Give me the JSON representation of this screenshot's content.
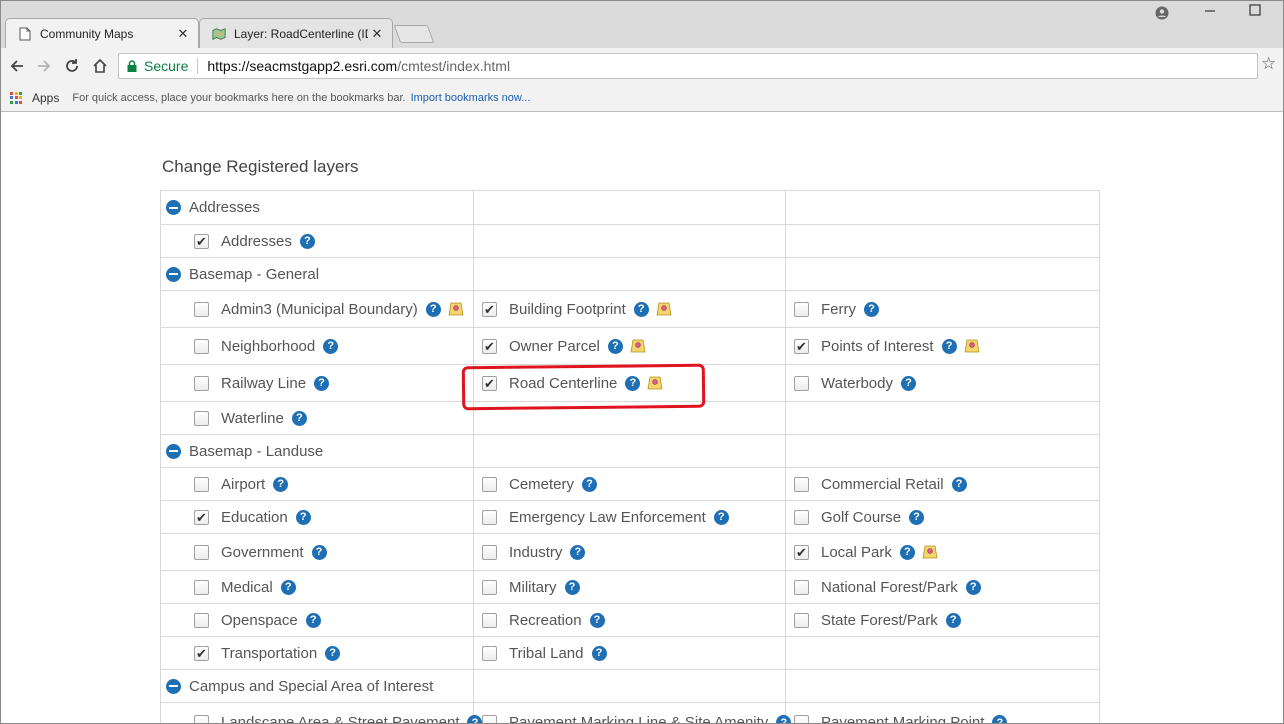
{
  "browser": {
    "tabs": [
      {
        "title": "Community Maps",
        "close": "✕",
        "icon": "page-icon"
      },
      {
        "title": "Layer: RoadCenterline (ID",
        "close": "✕",
        "icon": "map-icon"
      }
    ],
    "address": {
      "secure_label": "Secure",
      "url_host": "https://seacmstgapp2.esri.com",
      "url_path": "/cmtest/index.html"
    },
    "bookmarks": {
      "apps_label": "Apps",
      "hint": "For quick access, place your bookmarks here on the bookmarks bar.",
      "import_link": "Import bookmarks now..."
    }
  },
  "page": {
    "title": "Change Registered layers",
    "groups": [
      {
        "name": "Addresses",
        "rows": [
          [
            {
              "label": "Addresses",
              "checked": true,
              "tag": false
            },
            null,
            null
          ]
        ]
      },
      {
        "name": "Basemap - General",
        "rows": [
          [
            {
              "label": "Admin3 (Municipal Boundary)",
              "checked": false,
              "tag": true
            },
            {
              "label": "Building Footprint",
              "checked": true,
              "tag": true
            },
            {
              "label": "Ferry",
              "checked": false,
              "tag": false
            }
          ],
          [
            {
              "label": "Neighborhood",
              "checked": false,
              "tag": false
            },
            {
              "label": "Owner Parcel",
              "checked": true,
              "tag": true
            },
            {
              "label": "Points of Interest",
              "checked": true,
              "tag": true
            }
          ],
          [
            {
              "label": "Railway Line",
              "checked": false,
              "tag": false
            },
            {
              "label": "Road Centerline",
              "checked": true,
              "tag": true
            },
            {
              "label": "Waterbody",
              "checked": false,
              "tag": false
            }
          ],
          [
            {
              "label": "Waterline",
              "checked": false,
              "tag": false
            },
            null,
            null
          ]
        ]
      },
      {
        "name": "Basemap - Landuse",
        "rows": [
          [
            {
              "label": "Airport",
              "checked": false,
              "tag": false
            },
            {
              "label": "Cemetery",
              "checked": false,
              "tag": false
            },
            {
              "label": "Commercial Retail",
              "checked": false,
              "tag": false
            }
          ],
          [
            {
              "label": "Education",
              "checked": true,
              "tag": false
            },
            {
              "label": "Emergency Law Enforcement",
              "checked": false,
              "tag": false
            },
            {
              "label": "Golf Course",
              "checked": false,
              "tag": false
            }
          ],
          [
            {
              "label": "Government",
              "checked": false,
              "tag": false
            },
            {
              "label": "Industry",
              "checked": false,
              "tag": false
            },
            {
              "label": "Local Park",
              "checked": true,
              "tag": true
            }
          ],
          [
            {
              "label": "Medical",
              "checked": false,
              "tag": false
            },
            {
              "label": "Military",
              "checked": false,
              "tag": false
            },
            {
              "label": "National Forest/Park",
              "checked": false,
              "tag": false
            }
          ],
          [
            {
              "label": "Openspace",
              "checked": false,
              "tag": false
            },
            {
              "label": "Recreation",
              "checked": false,
              "tag": false
            },
            {
              "label": "State Forest/Park",
              "checked": false,
              "tag": false
            }
          ],
          [
            {
              "label": "Transportation",
              "checked": true,
              "tag": false
            },
            {
              "label": "Tribal Land",
              "checked": false,
              "tag": false
            },
            null
          ]
        ]
      },
      {
        "name": "Campus and Special Area of Interest",
        "rows": [
          [
            {
              "label": "Landscape Area & Street Pavement",
              "checked": false,
              "tag": false
            },
            {
              "label": "Pavement Marking Line & Site Amenity",
              "checked": false,
              "tag": false
            },
            {
              "label": "Pavement Marking Point",
              "checked": false,
              "tag": false
            }
          ]
        ]
      }
    ]
  },
  "annotation": {
    "target": "Road Centerline",
    "color": "#e0141e"
  },
  "colors": {
    "accent": "#1f6fb5",
    "secure": "#0b8043",
    "link": "#1a5fb4"
  }
}
